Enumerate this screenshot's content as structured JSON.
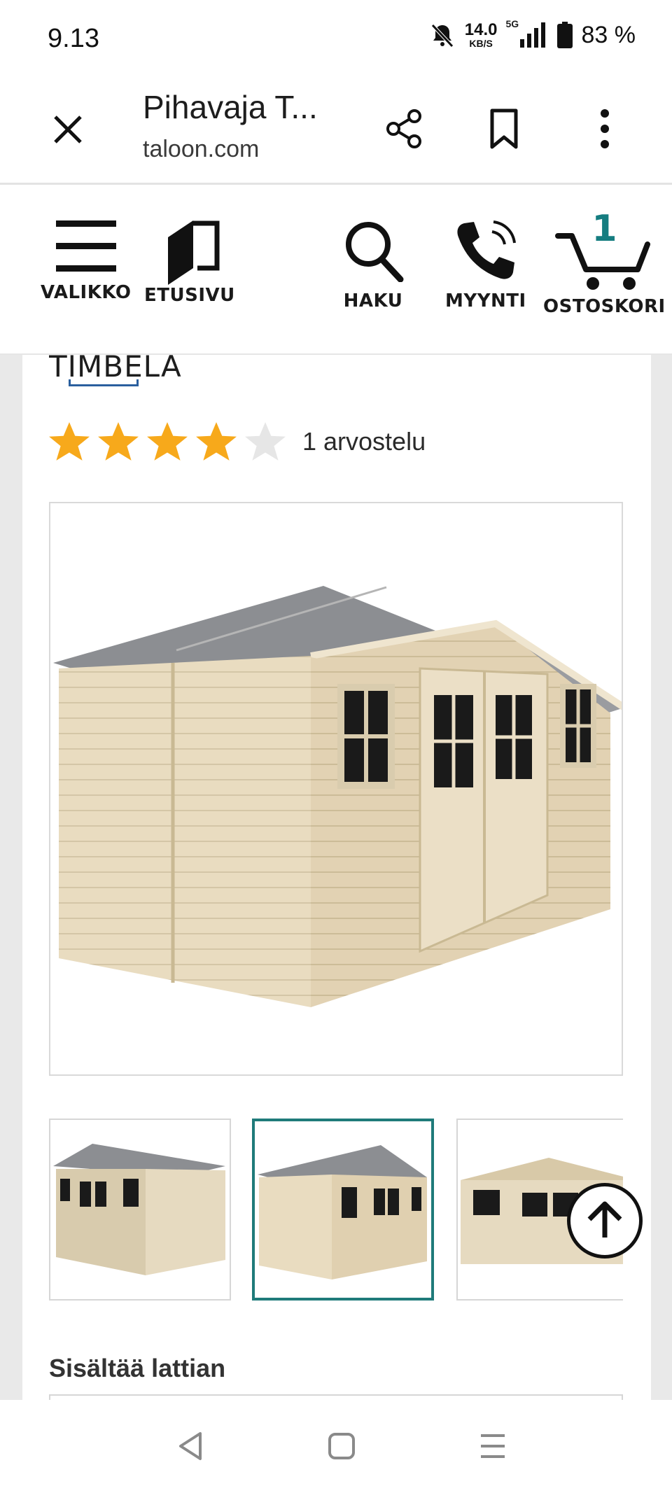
{
  "status_bar": {
    "time": "9.13",
    "net_speed_value": "14.0",
    "net_speed_unit": "KB/S",
    "network": "5G",
    "battery": "83 %",
    "icons": [
      "mute-icon",
      "signal-icon",
      "battery-icon"
    ]
  },
  "browser": {
    "title": "Pihavaja T...",
    "url": "taloon.com",
    "icons": [
      "close-icon",
      "share-icon",
      "bookmark-icon",
      "more-vert-icon"
    ]
  },
  "site_header": {
    "items": [
      {
        "label": "VALIKKO",
        "icon": "menu-icon"
      },
      {
        "label": "ETUSIVU",
        "icon": "door-icon"
      },
      {
        "label": "HAKU",
        "icon": "search-icon"
      },
      {
        "label": "MYYNTI",
        "icon": "phone-icon"
      },
      {
        "label": "OSTOSKORI",
        "icon": "cart-icon"
      }
    ],
    "cart_count": "1",
    "accent_color": "#157d80"
  },
  "product": {
    "brand": "TIMBELA",
    "rating": 4,
    "rating_max": 5,
    "review_text": "1 arvostelu",
    "selected_thumbnail": 2,
    "section_heading": "Sisältää lattian"
  },
  "nav_bar": {
    "icons": [
      "back-icon",
      "home-icon",
      "recent-apps-icon"
    ]
  }
}
